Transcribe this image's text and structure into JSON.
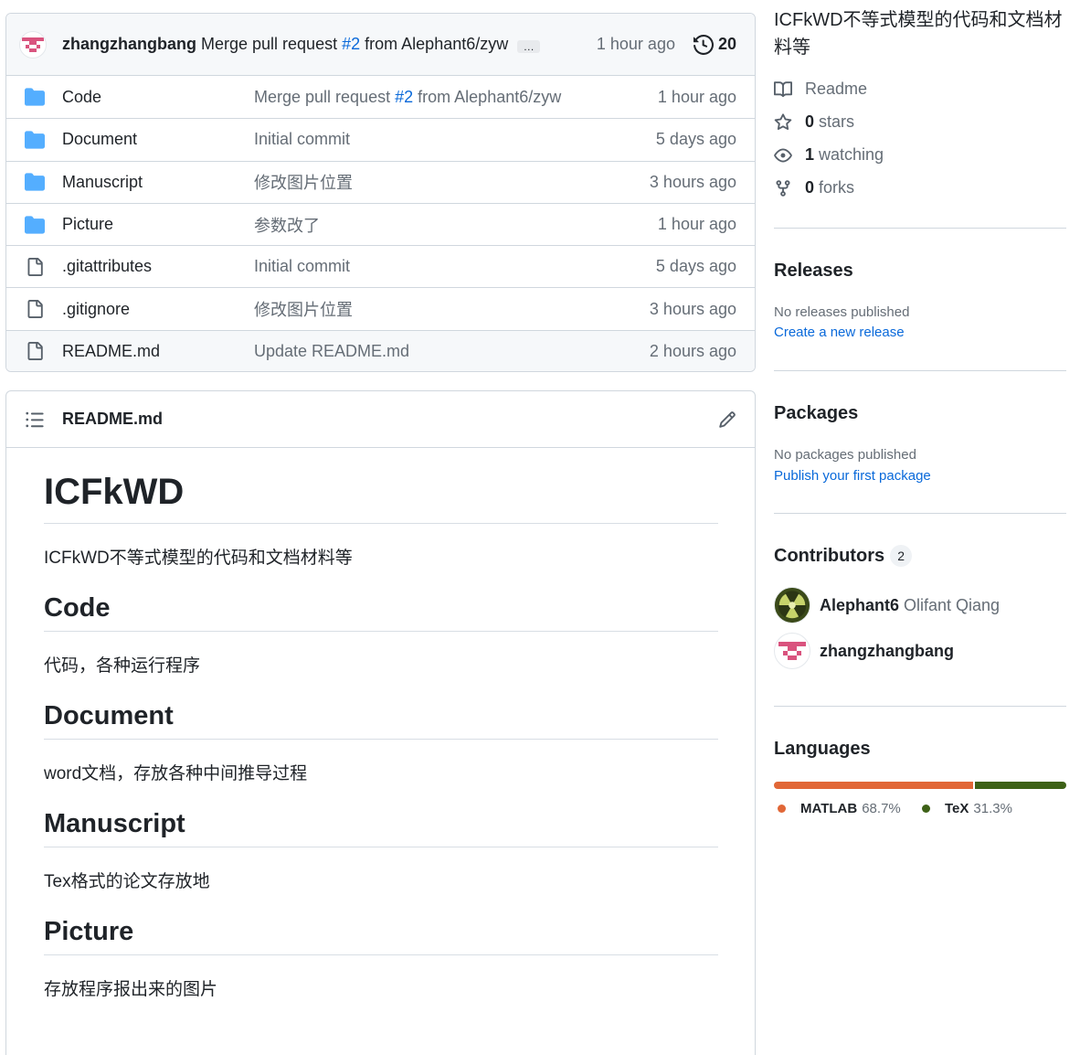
{
  "latest_commit": {
    "author": "zhangzhangbang",
    "message_prefix": "Merge pull request",
    "pr_link": "#2",
    "message_suffix": "from Alephant6/zyw",
    "ellipsis": "…",
    "time": "1 hour ago",
    "commit_count": "20"
  },
  "files": [
    {
      "type": "folder",
      "name": "Code",
      "msg_prefix": "Merge pull request",
      "msg_link": "#2",
      "msg_suffix": "from Alephant6/zyw",
      "time": "1 hour ago"
    },
    {
      "type": "folder",
      "name": "Document",
      "msg_prefix": "Initial commit",
      "msg_link": "",
      "msg_suffix": "",
      "time": "5 days ago"
    },
    {
      "type": "folder",
      "name": "Manuscript",
      "msg_prefix": "修改图片位置",
      "msg_link": "",
      "msg_suffix": "",
      "time": "3 hours ago"
    },
    {
      "type": "folder",
      "name": "Picture",
      "msg_prefix": "参数改了",
      "msg_link": "",
      "msg_suffix": "",
      "time": "1 hour ago"
    },
    {
      "type": "file",
      "name": ".gitattributes",
      "msg_prefix": "Initial commit",
      "msg_link": "",
      "msg_suffix": "",
      "time": "5 days ago"
    },
    {
      "type": "file",
      "name": ".gitignore",
      "msg_prefix": "修改图片位置",
      "msg_link": "",
      "msg_suffix": "",
      "time": "3 hours ago"
    },
    {
      "type": "file",
      "name": "README.md",
      "msg_prefix": "Update README.md",
      "msg_link": "",
      "msg_suffix": "",
      "time": "2 hours ago"
    }
  ],
  "readme": {
    "filename": "README.md",
    "h1": "ICFkWD",
    "intro": "ICFkWD不等式模型的代码和文档材料等",
    "sections": [
      {
        "heading": "Code",
        "text": "代码，各种运行程序"
      },
      {
        "heading": "Document",
        "text": "word文档，存放各种中间推导过程"
      },
      {
        "heading": "Manuscript",
        "text": "Tex格式的论文存放地"
      },
      {
        "heading": "Picture",
        "text": "存放程序报出来的图片"
      }
    ]
  },
  "sidebar": {
    "about": "ICFkWD不等式模型的代码和文档材料等",
    "readme_label": "Readme",
    "stars_count": "0",
    "stars_label": "stars",
    "watching_count": "1",
    "watching_label": "watching",
    "forks_count": "0",
    "forks_label": "forks",
    "releases": {
      "title": "Releases",
      "note": "No releases published",
      "link": "Create a new release"
    },
    "packages": {
      "title": "Packages",
      "note": "No packages published",
      "link": "Publish your first package"
    },
    "contributors": {
      "title": "Contributors",
      "count": "2",
      "list": [
        {
          "login": "Alephant6",
          "name": "Olifant Qiang"
        },
        {
          "login": "zhangzhangbang",
          "name": ""
        }
      ]
    },
    "languages": {
      "title": "Languages",
      "items": [
        {
          "name": "MATLAB",
          "percent": "68.7%",
          "value": 68.7,
          "color": "#e16737"
        },
        {
          "name": "TeX",
          "percent": "31.3%",
          "value": 31.3,
          "color": "#3d6117"
        }
      ]
    }
  }
}
